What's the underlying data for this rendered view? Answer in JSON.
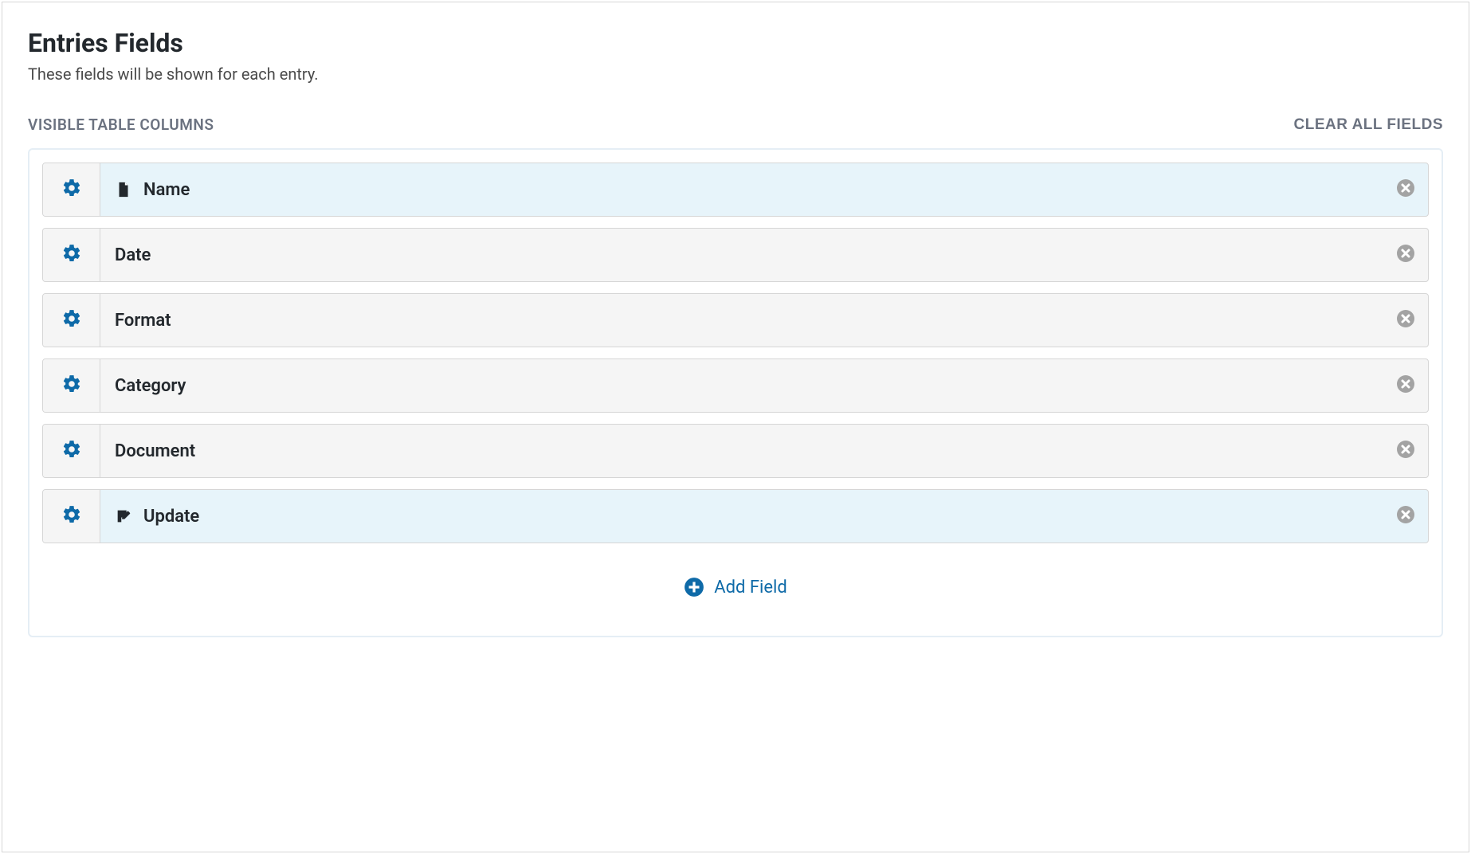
{
  "header": {
    "title": "Entries Fields",
    "subtitle": "These fields will be shown for each entry."
  },
  "section": {
    "label": "VISIBLE TABLE COLUMNS",
    "clear_all": "CLEAR ALL FIELDS"
  },
  "fields": [
    {
      "label": "Name",
      "icon": "document",
      "highlighted": true
    },
    {
      "label": "Date",
      "icon": null,
      "highlighted": false
    },
    {
      "label": "Format",
      "icon": null,
      "highlighted": false
    },
    {
      "label": "Category",
      "icon": null,
      "highlighted": false
    },
    {
      "label": "Document",
      "icon": null,
      "highlighted": false
    },
    {
      "label": "Update",
      "icon": "edit",
      "highlighted": true
    }
  ],
  "add_field": {
    "label": "Add Field"
  }
}
